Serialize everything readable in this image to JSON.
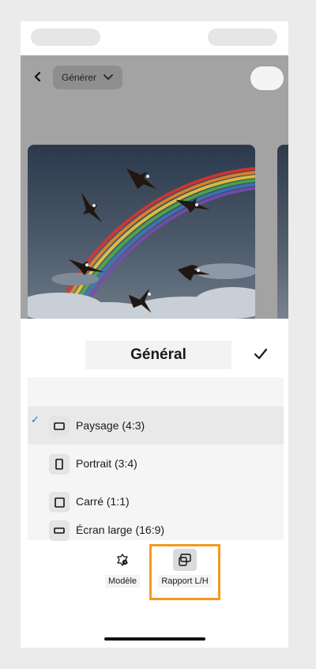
{
  "header": {
    "back_icon": "chevron-left-icon",
    "generate_label": "Générer",
    "generate_chevron": "chevron-down-icon"
  },
  "image": {
    "subject": "eagles-rainbow-sky"
  },
  "sheet": {
    "title": "Général",
    "confirm_icon": "checkmark-icon"
  },
  "aspect_options": [
    {
      "label": "Paysage (4:3)",
      "selected": true,
      "icon": "landscape-rect-icon"
    },
    {
      "label": "Portrait (3:4)",
      "selected": false,
      "icon": "portrait-rect-icon"
    },
    {
      "label": "Carré (1:1)",
      "selected": false,
      "icon": "square-icon"
    },
    {
      "label": "Écran large (16:9)",
      "selected": false,
      "icon": "widescreen-rect-icon"
    }
  ],
  "toolbar": {
    "model_label": "Modèle",
    "ratio_label": "Rapport L/H"
  },
  "colors": {
    "accent": "#1473e6",
    "highlight": "#f39a1f"
  }
}
